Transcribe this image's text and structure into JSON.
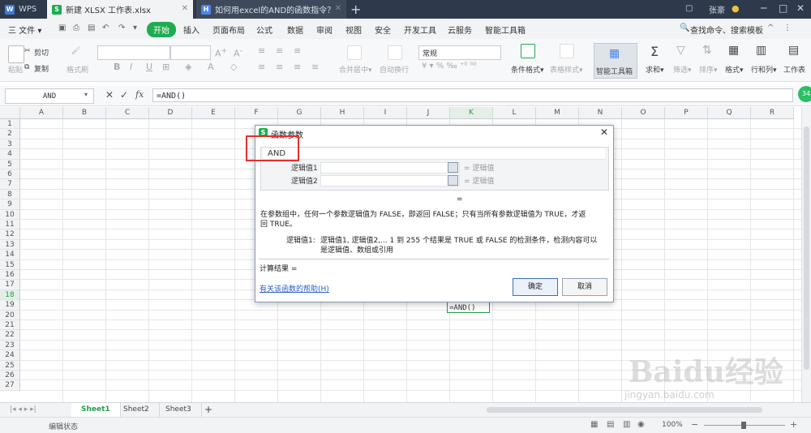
{
  "titlebar": {
    "app_tab": "WPS",
    "doc_tab": "新建 XLSX 工作表.xlsx",
    "web_tab": "如何用excel的AND的函数指令？",
    "user": "张豪"
  },
  "menu": {
    "file": "三 文件 ▾",
    "start": "开始",
    "items": [
      "插入",
      "页面布局",
      "公式",
      "数据",
      "审阅",
      "视图",
      "安全",
      "开发工具",
      "云服务",
      "智能工具箱"
    ],
    "search": "查找命令、搜索模板"
  },
  "ribbon": {
    "paste": "粘贴",
    "cut": "剪切",
    "copy": "复制",
    "format_painter": "格式刷",
    "merge_center": "合并居中▾",
    "auto_wrap": "自动换行",
    "number_format": "常规",
    "conditional_format": "条件格式▾",
    "table_style": "表格样式▾",
    "smart_toolbox": "智能工具箱",
    "sum": "求和▾",
    "filter": "筛选▾",
    "sort": "排序▾",
    "format": "格式▾",
    "row_col": "行和列▾",
    "worksheet": "工作表"
  },
  "formula_bar": {
    "name_box": "AND",
    "fx": "fx",
    "formula": "=AND()"
  },
  "grid": {
    "columns": [
      "A",
      "B",
      "C",
      "D",
      "E",
      "F",
      "G",
      "H",
      "I",
      "J",
      "K",
      "L",
      "M",
      "N",
      "O",
      "P",
      "Q",
      "R"
    ],
    "rows": [
      "1",
      "2",
      "3",
      "4",
      "5",
      "6",
      "7",
      "8",
      "9",
      "10",
      "11",
      "12",
      "13",
      "14",
      "15",
      "16",
      "17",
      "18",
      "19",
      "20",
      "21",
      "22",
      "23",
      "24",
      "25",
      "26",
      "27"
    ],
    "active_cell_value": "=AND()"
  },
  "dialog": {
    "title": "函数参数",
    "function_name": "AND",
    "arg1_label": "逻辑值1",
    "arg2_label": "逻辑值2",
    "arg_hint": "= 逻辑值",
    "result_eq": "=",
    "description": "在参数组中，任何一个参数逻辑值为 FALSE，即返回 FALSE；只有当所有参数逻辑值为 TRUE，才返回 TRUE。",
    "arg_desc_label": "逻辑值1:",
    "arg_desc": "逻辑值1, 逻辑值2,... 1 到 255 个结果是 TRUE 或 FALSE 的检测条件，检测内容可以是逻辑值、数组或引用",
    "calc_result": "计算结果  =",
    "help_link": "有关该函数的帮助(H)",
    "ok": "确定",
    "cancel": "取消"
  },
  "sheets": [
    "Sheet1",
    "Sheet2",
    "Sheet3"
  ],
  "status": {
    "mode": "编辑状态",
    "zoom": "100%"
  },
  "watermark": {
    "logo": "Baidu经验",
    "url": "jingyan.baidu.com"
  }
}
